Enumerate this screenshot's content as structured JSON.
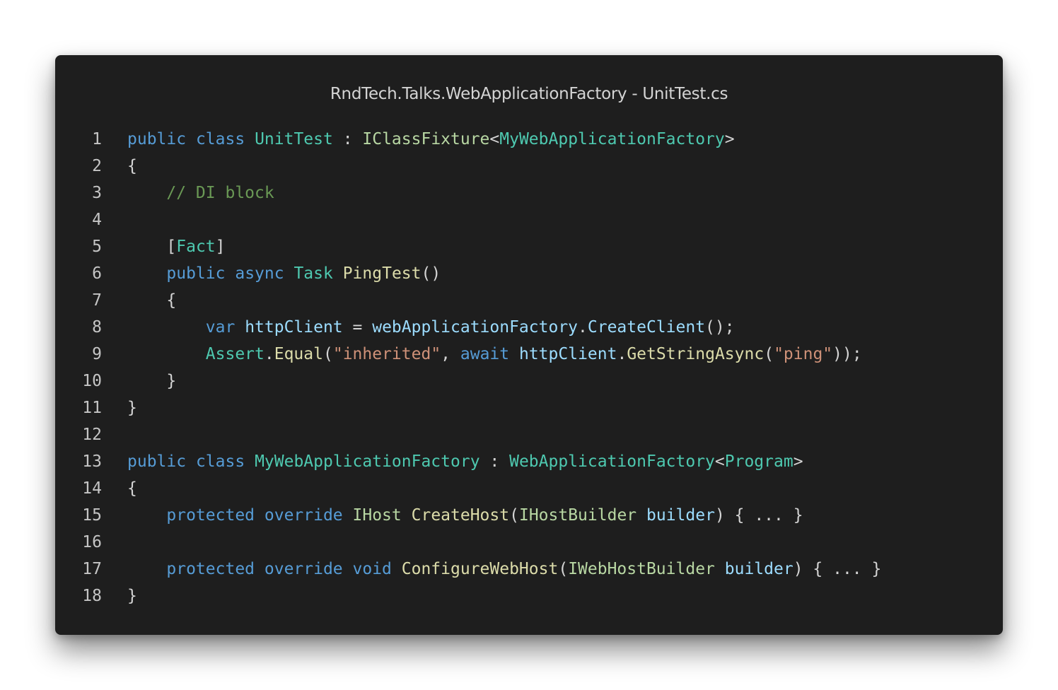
{
  "window": {
    "title": "RndTech.Talks.WebApplicationFactory - UnitTest.cs"
  },
  "editor": {
    "lines": [
      {
        "number": "1",
        "tokens": [
          {
            "text": "public",
            "kind": "kw"
          },
          {
            "text": " ",
            "kind": "pn"
          },
          {
            "text": "class",
            "kind": "kw"
          },
          {
            "text": " ",
            "kind": "pn"
          },
          {
            "text": "UnitTest",
            "kind": "ty"
          },
          {
            "text": " : ",
            "kind": "pn"
          },
          {
            "text": "IClassFixture",
            "kind": "if"
          },
          {
            "text": "<",
            "kind": "pn"
          },
          {
            "text": "MyWebApplicationFactory",
            "kind": "ty"
          },
          {
            "text": ">",
            "kind": "pn"
          }
        ]
      },
      {
        "number": "2",
        "tokens": [
          {
            "text": "{",
            "kind": "pn"
          }
        ]
      },
      {
        "number": "3",
        "tokens": [
          {
            "text": "    ",
            "kind": "pn"
          },
          {
            "text": "// DI block",
            "kind": "com"
          }
        ]
      },
      {
        "number": "4",
        "tokens": []
      },
      {
        "number": "5",
        "tokens": [
          {
            "text": "    [",
            "kind": "pn"
          },
          {
            "text": "Fact",
            "kind": "ty"
          },
          {
            "text": "]",
            "kind": "pn"
          }
        ]
      },
      {
        "number": "6",
        "tokens": [
          {
            "text": "    ",
            "kind": "pn"
          },
          {
            "text": "public",
            "kind": "kw"
          },
          {
            "text": " ",
            "kind": "pn"
          },
          {
            "text": "async",
            "kind": "kw"
          },
          {
            "text": " ",
            "kind": "pn"
          },
          {
            "text": "Task",
            "kind": "ty"
          },
          {
            "text": " ",
            "kind": "pn"
          },
          {
            "text": "PingTest",
            "kind": "fn"
          },
          {
            "text": "()",
            "kind": "pn"
          }
        ]
      },
      {
        "number": "7",
        "tokens": [
          {
            "text": "    {",
            "kind": "pn"
          }
        ]
      },
      {
        "number": "8",
        "tokens": [
          {
            "text": "        ",
            "kind": "pn"
          },
          {
            "text": "var",
            "kind": "kw"
          },
          {
            "text": " ",
            "kind": "pn"
          },
          {
            "text": "httpClient",
            "kind": "var"
          },
          {
            "text": " = ",
            "kind": "pn"
          },
          {
            "text": "webApplicationFactory",
            "kind": "var"
          },
          {
            "text": ".",
            "kind": "pn"
          },
          {
            "text": "CreateClient",
            "kind": "var"
          },
          {
            "text": "();",
            "kind": "pn"
          }
        ]
      },
      {
        "number": "9",
        "tokens": [
          {
            "text": "        ",
            "kind": "pn"
          },
          {
            "text": "Assert",
            "kind": "ty"
          },
          {
            "text": ".",
            "kind": "pn"
          },
          {
            "text": "Equal",
            "kind": "fn"
          },
          {
            "text": "(",
            "kind": "pn"
          },
          {
            "text": "\"inherited\"",
            "kind": "str"
          },
          {
            "text": ", ",
            "kind": "pn"
          },
          {
            "text": "await",
            "kind": "kw"
          },
          {
            "text": " ",
            "kind": "pn"
          },
          {
            "text": "httpClient",
            "kind": "var"
          },
          {
            "text": ".",
            "kind": "pn"
          },
          {
            "text": "GetStringAsync",
            "kind": "fn"
          },
          {
            "text": "(",
            "kind": "pn"
          },
          {
            "text": "\"ping\"",
            "kind": "str"
          },
          {
            "text": "));",
            "kind": "pn"
          }
        ]
      },
      {
        "number": "10",
        "tokens": [
          {
            "text": "    }",
            "kind": "pn"
          }
        ]
      },
      {
        "number": "11",
        "tokens": [
          {
            "text": "}",
            "kind": "pn"
          }
        ]
      },
      {
        "number": "12",
        "tokens": []
      },
      {
        "number": "13",
        "tokens": [
          {
            "text": "public",
            "kind": "kw"
          },
          {
            "text": " ",
            "kind": "pn"
          },
          {
            "text": "class",
            "kind": "kw"
          },
          {
            "text": " ",
            "kind": "pn"
          },
          {
            "text": "MyWebApplicationFactory",
            "kind": "ty"
          },
          {
            "text": " : ",
            "kind": "pn"
          },
          {
            "text": "WebApplicationFactory",
            "kind": "ty"
          },
          {
            "text": "<",
            "kind": "pn"
          },
          {
            "text": "Program",
            "kind": "ty"
          },
          {
            "text": ">",
            "kind": "pn"
          }
        ]
      },
      {
        "number": "14",
        "tokens": [
          {
            "text": "{",
            "kind": "pn"
          }
        ]
      },
      {
        "number": "15",
        "tokens": [
          {
            "text": "    ",
            "kind": "pn"
          },
          {
            "text": "protected",
            "kind": "kw"
          },
          {
            "text": " ",
            "kind": "pn"
          },
          {
            "text": "override",
            "kind": "kw"
          },
          {
            "text": " ",
            "kind": "pn"
          },
          {
            "text": "IHost",
            "kind": "if"
          },
          {
            "text": " ",
            "kind": "pn"
          },
          {
            "text": "CreateHost",
            "kind": "fn"
          },
          {
            "text": "(",
            "kind": "pn"
          },
          {
            "text": "IHostBuilder",
            "kind": "if"
          },
          {
            "text": " ",
            "kind": "pn"
          },
          {
            "text": "builder",
            "kind": "var"
          },
          {
            "text": ") { ... }",
            "kind": "pn"
          }
        ]
      },
      {
        "number": "16",
        "tokens": []
      },
      {
        "number": "17",
        "tokens": [
          {
            "text": "    ",
            "kind": "pn"
          },
          {
            "text": "protected",
            "kind": "kw"
          },
          {
            "text": " ",
            "kind": "pn"
          },
          {
            "text": "override",
            "kind": "kw"
          },
          {
            "text": " ",
            "kind": "pn"
          },
          {
            "text": "void",
            "kind": "kw"
          },
          {
            "text": " ",
            "kind": "pn"
          },
          {
            "text": "ConfigureWebHost",
            "kind": "fn"
          },
          {
            "text": "(",
            "kind": "pn"
          },
          {
            "text": "IWebHostBuilder",
            "kind": "if"
          },
          {
            "text": " ",
            "kind": "pn"
          },
          {
            "text": "builder",
            "kind": "var"
          },
          {
            "text": ") { ... }",
            "kind": "pn"
          }
        ]
      },
      {
        "number": "18",
        "tokens": [
          {
            "text": "}",
            "kind": "pn"
          }
        ]
      }
    ]
  },
  "colors": {
    "background": "#1e1e1e",
    "keyword": "#569cd6",
    "type": "#4ec9b0",
    "interface": "#b8d7a3",
    "function": "#dcdcaa",
    "variable": "#9cdcfe",
    "string": "#ce9178",
    "comment": "#6a9955",
    "punctuation": "#d4d4d4",
    "line_number": "#c5c5c5"
  }
}
